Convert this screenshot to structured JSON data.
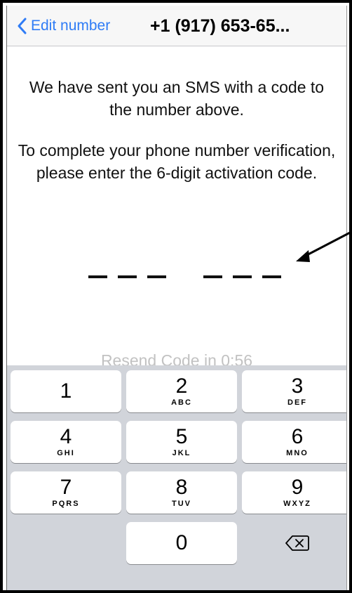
{
  "nav": {
    "back_label": "Edit number",
    "title": "+1 (917) 653-65..."
  },
  "body": {
    "message_1": "We have sent you an SMS with a code to the number above.",
    "message_2": "To complete your phone number verification, please enter the 6-digit activation code.",
    "code_placeholder": "___ ___",
    "resend": "Resend Code in 0:56"
  },
  "keypad": {
    "keys": [
      {
        "num": "1",
        "letters": ""
      },
      {
        "num": "2",
        "letters": "ABC"
      },
      {
        "num": "3",
        "letters": "DEF"
      },
      {
        "num": "4",
        "letters": "GHI"
      },
      {
        "num": "5",
        "letters": "JKL"
      },
      {
        "num": "6",
        "letters": "MNO"
      },
      {
        "num": "7",
        "letters": "PQRS"
      },
      {
        "num": "8",
        "letters": "TUV"
      },
      {
        "num": "9",
        "letters": "WXYZ"
      },
      {
        "num": "0",
        "letters": ""
      }
    ],
    "delete_icon": "backspace-icon"
  },
  "annotation": {
    "arrow_icon": "pointer-arrow-icon"
  },
  "colors": {
    "accent": "#2f7cf6",
    "keypad_bg": "#d1d4da",
    "resend_gray": "#c2c2c2"
  }
}
